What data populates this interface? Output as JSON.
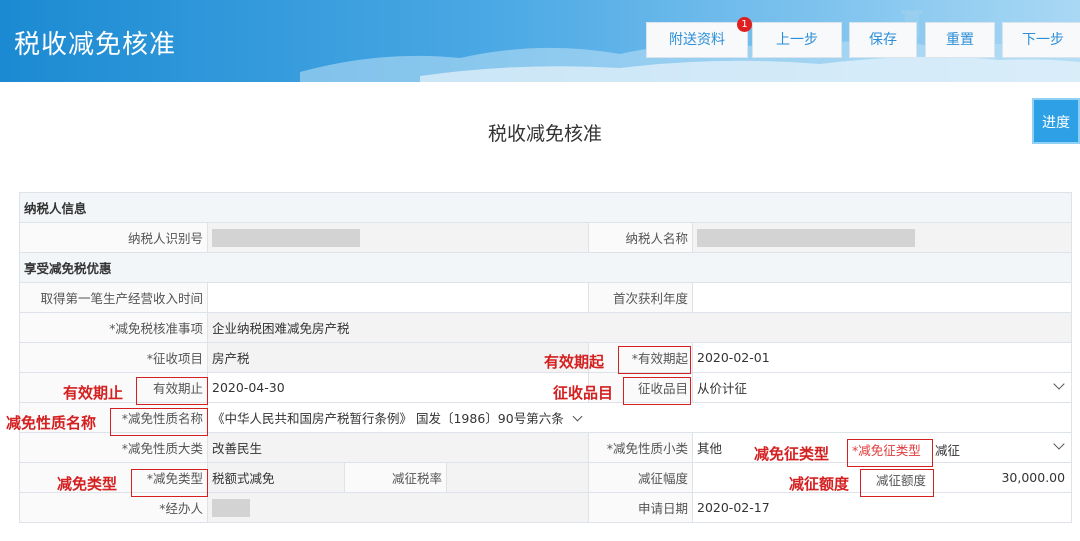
{
  "app": {
    "title": "税收减免核准"
  },
  "toolbar": {
    "attachments_label": "附送资料",
    "attachments_badge": "1",
    "prev_label": "上一步",
    "save_label": "保存",
    "reset_label": "重置",
    "next_label": "下一步"
  },
  "form": {
    "title": "税收减免核准",
    "progress_label": "进度",
    "section_taxpayer": "纳税人信息",
    "taxpayer_id_label": "纳税人识别号",
    "taxpayer_name_label": "纳税人名称",
    "section_relief": "享受减免税优惠",
    "first_income_time_label": "取得第一笔生产经营收入时间",
    "first_profit_year_label": "首次获利年度",
    "relief_item_label": "*减免税核准事项",
    "relief_item_value": "企业纳税困难减免房产税",
    "levy_project_label": "*征收项目",
    "levy_project_value": "房产税",
    "valid_from_label": "*有效期起",
    "valid_from_value": "2020-02-01",
    "valid_to_label": "有效期止",
    "valid_to_value": "2020-04-30",
    "levy_item_label": "征收品目",
    "levy_item_value": "从价计征",
    "relief_nature_name_label": "*减免性质名称",
    "relief_nature_name_value": "《中华人民共和国房产税暂行条例》 国发〔1986〕90号第六条",
    "relief_nature_major_label": "*减免性质大类",
    "relief_nature_major_value": "改善民生",
    "relief_nature_minor_label": "*减免性质小类",
    "relief_nature_minor_value": "其他",
    "relief_levy_type_label": "*减免征类型",
    "relief_levy_type_value": "减征",
    "relief_type_label": "*减免类型",
    "relief_type_value": "税额式减免",
    "levy_rate_label": "减征税率",
    "levy_range_label": "减征幅度",
    "levy_amount_label": "减征额度",
    "levy_amount_value": "30,000.00",
    "handler_label": "*经办人",
    "apply_date_label": "申请日期",
    "apply_date_value": "2020-02-17"
  },
  "annotations": {
    "valid_from": "有效期起",
    "valid_to": "有效期止",
    "levy_item": "征收品目",
    "relief_nature_name": "减免性质名称",
    "relief_levy_type": "减免征类型",
    "relief_type": "减免类型",
    "levy_amount": "减征额度"
  },
  "colors": {
    "header_blue": "#1b8ad2",
    "toolbar_text": "#2e8fd8",
    "annotation_red": "#d42020",
    "required_red": "#e03c3c",
    "progress_button": "#2ea1e6"
  }
}
